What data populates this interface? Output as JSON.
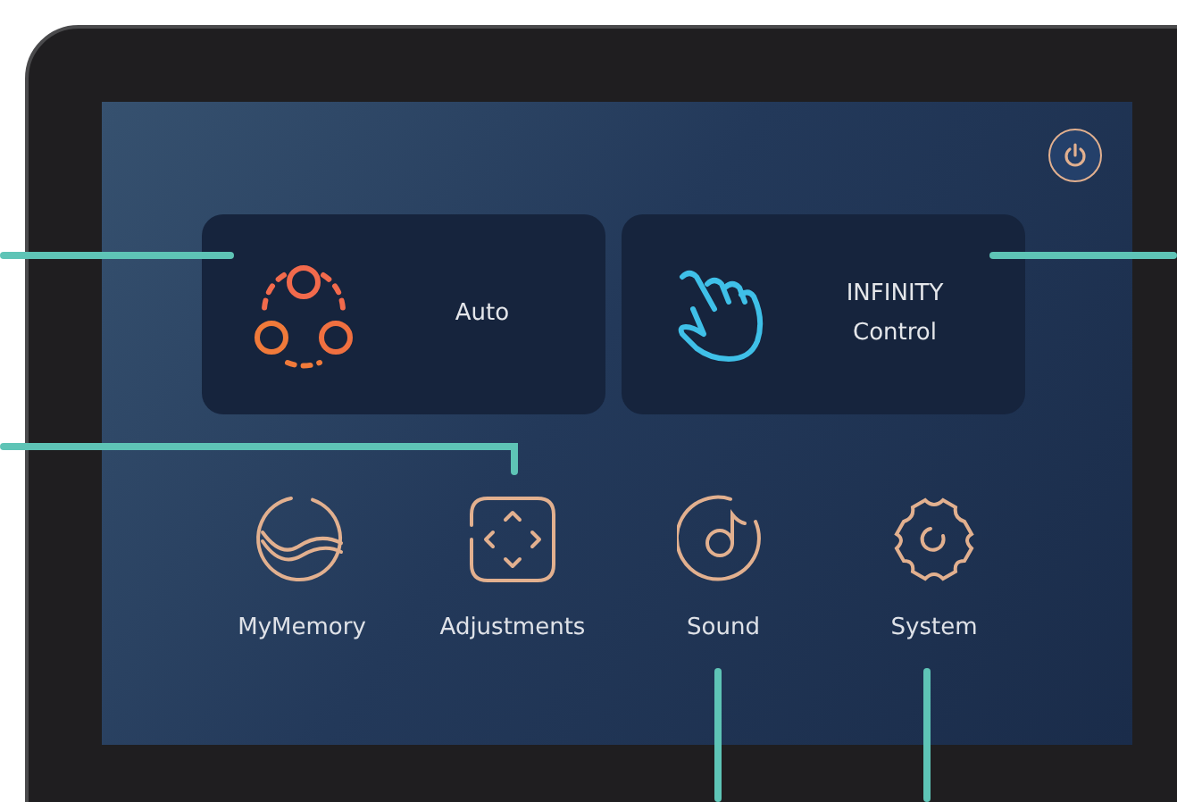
{
  "cards": [
    {
      "label": "Auto"
    },
    {
      "label": "INFINITY Control"
    }
  ],
  "apps": [
    {
      "label": "MyMemory"
    },
    {
      "label": "Adjustments"
    },
    {
      "label": "Sound"
    },
    {
      "label": "System"
    }
  ]
}
